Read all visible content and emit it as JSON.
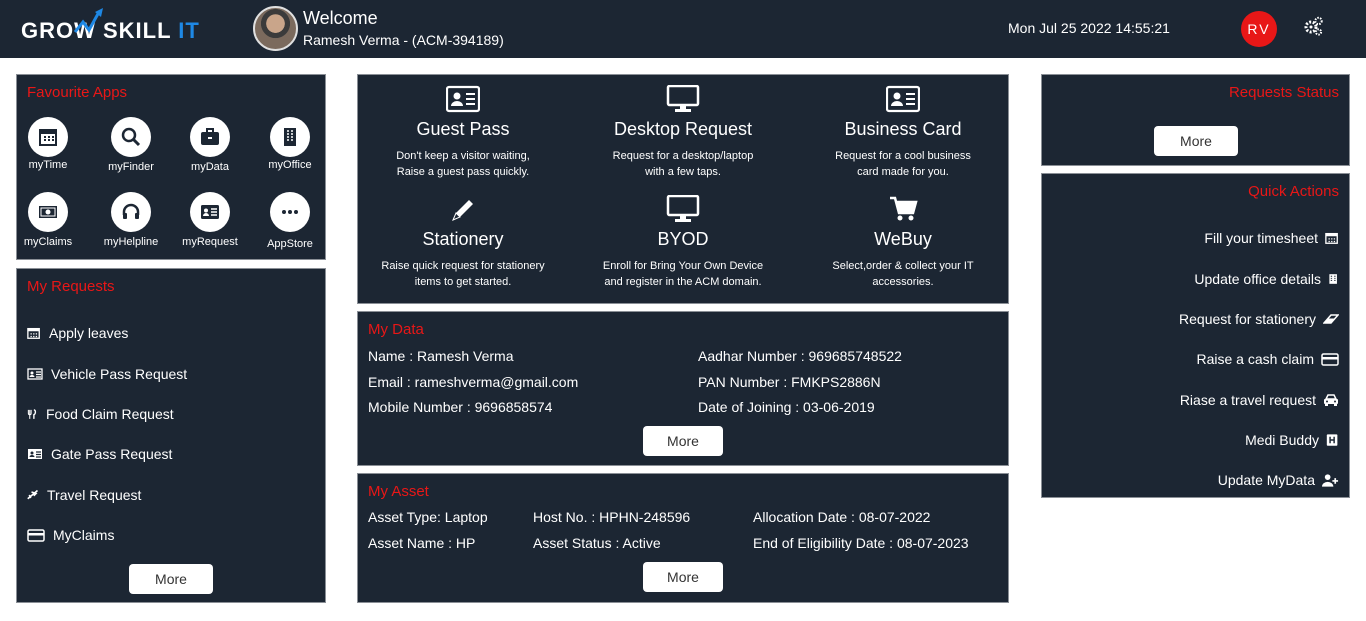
{
  "header": {
    "logo_text": "GROW SKILL",
    "logo_accent": "IT",
    "welcome": "Welcome",
    "user": "Ramesh Verma - (ACM-394189)",
    "datetime": "Mon Jul 25 2022 14:55:21",
    "initials": "RV",
    "settings_icon": "gears-icon"
  },
  "favourite_apps": {
    "title": "Favourite Apps",
    "apps": [
      {
        "label": "myTime",
        "icon": "calendar-icon"
      },
      {
        "label": "myFinder",
        "icon": "search-icon"
      },
      {
        "label": "myData",
        "icon": "briefcase-icon"
      },
      {
        "label": "myOffice",
        "icon": "building-icon"
      },
      {
        "label": "myClaims",
        "icon": "money-icon"
      },
      {
        "label": "myHelpline",
        "icon": "headset-icon"
      },
      {
        "label": "myRequest",
        "icon": "id-card-icon"
      },
      {
        "label": "AppStore",
        "icon": "ellipsis-icon"
      }
    ]
  },
  "my_requests": {
    "title": "My Requests",
    "items": [
      {
        "label": "Apply leaves",
        "icon": "calendar-icon"
      },
      {
        "label": "Vehicle Pass Request",
        "icon": "id-card-icon"
      },
      {
        "label": "Food Claim Request",
        "icon": "utensils-icon"
      },
      {
        "label": "Gate Pass Request",
        "icon": "id-card-icon"
      },
      {
        "label": "Travel Request",
        "icon": "plane-icon"
      },
      {
        "label": "MyClaims",
        "icon": "credit-card-icon"
      }
    ],
    "more": "More"
  },
  "services": [
    {
      "title": "Guest Pass",
      "desc1": "Don't keep a visitor waiting,",
      "desc2": "Raise a guest pass quickly.",
      "icon": "id-card-icon"
    },
    {
      "title": "Desktop Request",
      "desc1": "Request for a desktop/laptop",
      "desc2": "with a few taps.",
      "icon": "desktop-icon"
    },
    {
      "title": "Business Card",
      "desc1": "Request for a cool business",
      "desc2": "card made for you.",
      "icon": "id-card-icon"
    },
    {
      "title": "Stationery",
      "desc1": "Raise quick request for stationery",
      "desc2": "items to get started.",
      "icon": "pencil-icon"
    },
    {
      "title": "BYOD",
      "desc1": "Enroll for Bring Your Own Device",
      "desc2": "and register in the ACM domain.",
      "icon": "desktop-icon"
    },
    {
      "title": "WeBuy",
      "desc1": "Select,order & collect your IT",
      "desc2": "accessories.",
      "icon": "cart-icon"
    }
  ],
  "my_data": {
    "title": "My Data",
    "name": "Name : Ramesh Verma",
    "email": "Email : rameshverma@gmail.com",
    "mobile": "Mobile Number : 9696858574",
    "aadhar": "Aadhar Number : 969685748522",
    "pan": "PAN Number : FMKPS2886N",
    "doj": "Date of Joining : 03-06-2019",
    "more": "More"
  },
  "my_asset": {
    "title": "My Asset",
    "type": "Asset Type: Laptop",
    "name": "Asset Name : HP",
    "host": "Host No. : HPHN-248596",
    "status": "Asset Status : Active",
    "alloc": "Allocation Date : 08-07-2022",
    "eol": "End of Eligibility Date : 08-07-2023",
    "more": "More"
  },
  "requests_status": {
    "title": "Requests Status",
    "more": "More"
  },
  "quick_actions": {
    "title": "Quick Actions",
    "items": [
      {
        "label": "Fill your timesheet",
        "icon": "calendar-icon"
      },
      {
        "label": "Update office details",
        "icon": "building-icon"
      },
      {
        "label": "Request for stationery",
        "icon": "eraser-icon"
      },
      {
        "label": "Raise a cash claim",
        "icon": "credit-card-icon"
      },
      {
        "label": "Riase a travel request",
        "icon": "car-icon"
      },
      {
        "label": "Medi Buddy",
        "icon": "hospital-icon"
      },
      {
        "label": "Update MyData",
        "icon": "user-plus-icon"
      }
    ]
  }
}
